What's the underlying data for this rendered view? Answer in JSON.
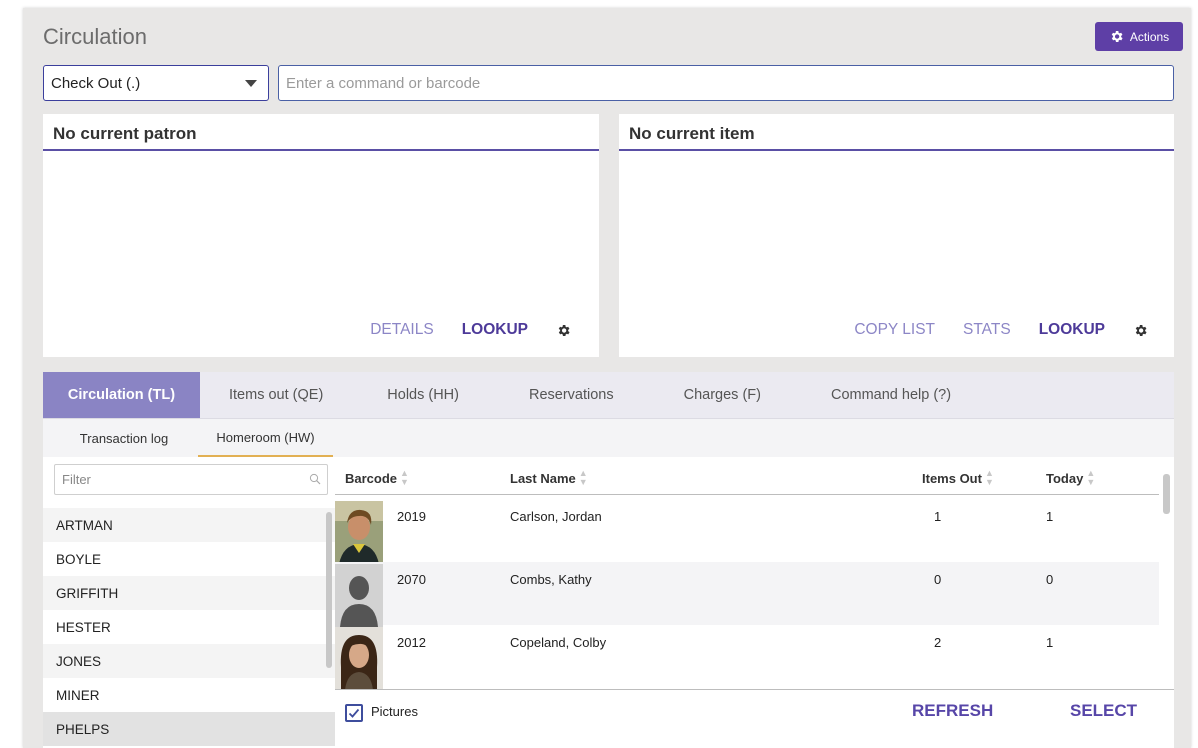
{
  "header": {
    "title": "Circulation",
    "actions_label": "Actions"
  },
  "command_bar": {
    "mode_value": "Check Out (.)",
    "input_placeholder": "Enter a command or barcode",
    "input_value": ""
  },
  "patron_panel": {
    "title": "No current patron",
    "details_label": "DETAILS",
    "lookup_label": "LOOKUP"
  },
  "item_panel": {
    "title": "No current item",
    "copy_list_label": "COPY LIST",
    "stats_label": "STATS",
    "lookup_label": "LOOKUP"
  },
  "tabs": [
    {
      "label": "Circulation (TL)",
      "active": true
    },
    {
      "label": "Items out (QE)",
      "active": false
    },
    {
      "label": "Holds (HH)",
      "active": false
    },
    {
      "label": "Reservations",
      "active": false
    },
    {
      "label": "Charges (F)",
      "active": false
    },
    {
      "label": "Command help (?)",
      "active": false
    }
  ],
  "subtabs": [
    {
      "label": "Transaction log",
      "active": false
    },
    {
      "label": "Homeroom (HW)",
      "active": true
    }
  ],
  "homeroom": {
    "filter_placeholder": "Filter",
    "filter_value": "",
    "items": [
      "ARTMAN",
      "BOYLE",
      "GRIFFITH",
      "HESTER",
      "JONES",
      "MINER",
      "PHELPS"
    ]
  },
  "grid": {
    "columns": [
      "Barcode",
      "Last Name",
      "Items Out",
      "Today"
    ],
    "rows": [
      {
        "barcode": "2019",
        "name": "Carlson, Jordan",
        "items_out": "1",
        "today": "1",
        "photo": "student-photo-boy"
      },
      {
        "barcode": "2070",
        "name": "Combs, Kathy",
        "items_out": "0",
        "today": "0",
        "photo": "placeholder-silhouette"
      },
      {
        "barcode": "2012",
        "name": "Copeland, Colby",
        "items_out": "2",
        "today": "1",
        "photo": "student-photo-girl"
      }
    ],
    "pictures_label": "Pictures",
    "pictures_checked": true,
    "refresh_label": "REFRESH",
    "select_label": "SELECT"
  },
  "colors": {
    "accent": "#5e3fa6",
    "tab_active": "#8a84c4",
    "link_strong": "#4d3a99",
    "link_dim": "#8c86c6",
    "subtab_underline": "#e2b053"
  }
}
